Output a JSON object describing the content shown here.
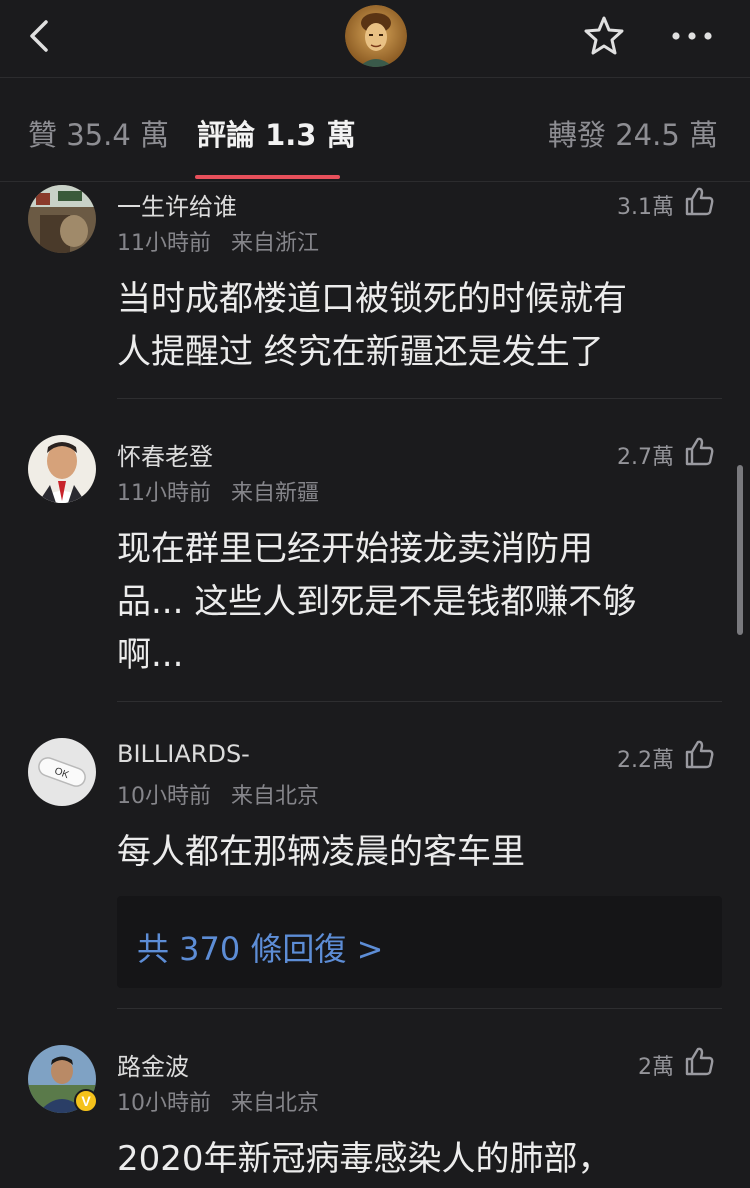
{
  "header": {
    "back_icon": "chevron-left-icon",
    "avatar_icon": "user-avatar",
    "favorite_icon": "star-icon",
    "more_icon": "more-horizontal-icon"
  },
  "tabs": [
    {
      "label": "贊 35.4 萬",
      "active": false
    },
    {
      "label": "評論 1.3 萬",
      "active": true
    },
    {
      "label": "轉發 24.5 萬",
      "active": false
    }
  ],
  "colors": {
    "accent": "#e8505b",
    "link": "#5d8dd6",
    "background": "#1b1b1d",
    "verified": "#f5c21b"
  },
  "comments": [
    {
      "name": "一生许给谁",
      "time": "11小時前",
      "location": "来自浙江",
      "likes": "3.1萬",
      "lines": [
        "当时成都楼道口被锁死的时候就有",
        "人提醒过 终究在新疆还是发生了"
      ]
    },
    {
      "name": "怀春老登",
      "time": "11小時前",
      "location": "来自新疆",
      "likes": "2.7萬",
      "lines": [
        "现在群里已经开始接龙卖消防用",
        "品... 这些人到死是不是钱都赚不够",
        "啊..."
      ]
    },
    {
      "name": "BILLIARDS-",
      "time": "10小時前",
      "location": "来自北京",
      "likes": "2.2萬",
      "avatar_text": "OK",
      "lines": [
        "每人都在那辆凌晨的客车里"
      ],
      "replies_label": "共 370 條回復 >"
    },
    {
      "name": "路金波",
      "time": "10小時前",
      "location": "来自北京",
      "likes": "2萬",
      "verified_badge": "V",
      "lines": [
        "2020年新冠病毒感染人的肺部，"
      ]
    }
  ]
}
